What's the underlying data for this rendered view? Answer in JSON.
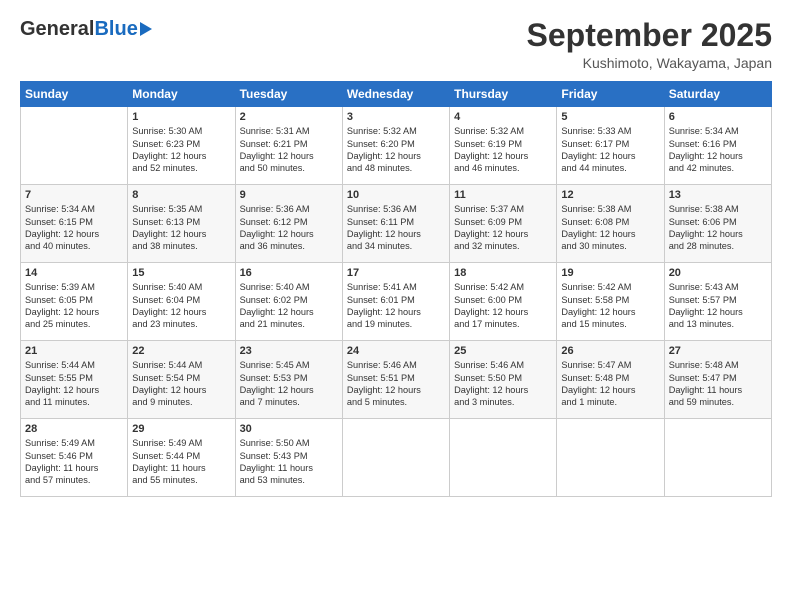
{
  "logo": {
    "general": "General",
    "blue": "Blue"
  },
  "title": "September 2025",
  "subtitle": "Kushimoto, Wakayama, Japan",
  "days_of_week": [
    "Sunday",
    "Monday",
    "Tuesday",
    "Wednesday",
    "Thursday",
    "Friday",
    "Saturday"
  ],
  "weeks": [
    [
      {
        "num": "",
        "text": ""
      },
      {
        "num": "1",
        "text": "Sunrise: 5:30 AM\nSunset: 6:23 PM\nDaylight: 12 hours\nand 52 minutes."
      },
      {
        "num": "2",
        "text": "Sunrise: 5:31 AM\nSunset: 6:21 PM\nDaylight: 12 hours\nand 50 minutes."
      },
      {
        "num": "3",
        "text": "Sunrise: 5:32 AM\nSunset: 6:20 PM\nDaylight: 12 hours\nand 48 minutes."
      },
      {
        "num": "4",
        "text": "Sunrise: 5:32 AM\nSunset: 6:19 PM\nDaylight: 12 hours\nand 46 minutes."
      },
      {
        "num": "5",
        "text": "Sunrise: 5:33 AM\nSunset: 6:17 PM\nDaylight: 12 hours\nand 44 minutes."
      },
      {
        "num": "6",
        "text": "Sunrise: 5:34 AM\nSunset: 6:16 PM\nDaylight: 12 hours\nand 42 minutes."
      }
    ],
    [
      {
        "num": "7",
        "text": "Sunrise: 5:34 AM\nSunset: 6:15 PM\nDaylight: 12 hours\nand 40 minutes."
      },
      {
        "num": "8",
        "text": "Sunrise: 5:35 AM\nSunset: 6:13 PM\nDaylight: 12 hours\nand 38 minutes."
      },
      {
        "num": "9",
        "text": "Sunrise: 5:36 AM\nSunset: 6:12 PM\nDaylight: 12 hours\nand 36 minutes."
      },
      {
        "num": "10",
        "text": "Sunrise: 5:36 AM\nSunset: 6:11 PM\nDaylight: 12 hours\nand 34 minutes."
      },
      {
        "num": "11",
        "text": "Sunrise: 5:37 AM\nSunset: 6:09 PM\nDaylight: 12 hours\nand 32 minutes."
      },
      {
        "num": "12",
        "text": "Sunrise: 5:38 AM\nSunset: 6:08 PM\nDaylight: 12 hours\nand 30 minutes."
      },
      {
        "num": "13",
        "text": "Sunrise: 5:38 AM\nSunset: 6:06 PM\nDaylight: 12 hours\nand 28 minutes."
      }
    ],
    [
      {
        "num": "14",
        "text": "Sunrise: 5:39 AM\nSunset: 6:05 PM\nDaylight: 12 hours\nand 25 minutes."
      },
      {
        "num": "15",
        "text": "Sunrise: 5:40 AM\nSunset: 6:04 PM\nDaylight: 12 hours\nand 23 minutes."
      },
      {
        "num": "16",
        "text": "Sunrise: 5:40 AM\nSunset: 6:02 PM\nDaylight: 12 hours\nand 21 minutes."
      },
      {
        "num": "17",
        "text": "Sunrise: 5:41 AM\nSunset: 6:01 PM\nDaylight: 12 hours\nand 19 minutes."
      },
      {
        "num": "18",
        "text": "Sunrise: 5:42 AM\nSunset: 6:00 PM\nDaylight: 12 hours\nand 17 minutes."
      },
      {
        "num": "19",
        "text": "Sunrise: 5:42 AM\nSunset: 5:58 PM\nDaylight: 12 hours\nand 15 minutes."
      },
      {
        "num": "20",
        "text": "Sunrise: 5:43 AM\nSunset: 5:57 PM\nDaylight: 12 hours\nand 13 minutes."
      }
    ],
    [
      {
        "num": "21",
        "text": "Sunrise: 5:44 AM\nSunset: 5:55 PM\nDaylight: 12 hours\nand 11 minutes."
      },
      {
        "num": "22",
        "text": "Sunrise: 5:44 AM\nSunset: 5:54 PM\nDaylight: 12 hours\nand 9 minutes."
      },
      {
        "num": "23",
        "text": "Sunrise: 5:45 AM\nSunset: 5:53 PM\nDaylight: 12 hours\nand 7 minutes."
      },
      {
        "num": "24",
        "text": "Sunrise: 5:46 AM\nSunset: 5:51 PM\nDaylight: 12 hours\nand 5 minutes."
      },
      {
        "num": "25",
        "text": "Sunrise: 5:46 AM\nSunset: 5:50 PM\nDaylight: 12 hours\nand 3 minutes."
      },
      {
        "num": "26",
        "text": "Sunrise: 5:47 AM\nSunset: 5:48 PM\nDaylight: 12 hours\nand 1 minute."
      },
      {
        "num": "27",
        "text": "Sunrise: 5:48 AM\nSunset: 5:47 PM\nDaylight: 11 hours\nand 59 minutes."
      }
    ],
    [
      {
        "num": "28",
        "text": "Sunrise: 5:49 AM\nSunset: 5:46 PM\nDaylight: 11 hours\nand 57 minutes."
      },
      {
        "num": "29",
        "text": "Sunrise: 5:49 AM\nSunset: 5:44 PM\nDaylight: 11 hours\nand 55 minutes."
      },
      {
        "num": "30",
        "text": "Sunrise: 5:50 AM\nSunset: 5:43 PM\nDaylight: 11 hours\nand 53 minutes."
      },
      {
        "num": "",
        "text": ""
      },
      {
        "num": "",
        "text": ""
      },
      {
        "num": "",
        "text": ""
      },
      {
        "num": "",
        "text": ""
      }
    ]
  ]
}
